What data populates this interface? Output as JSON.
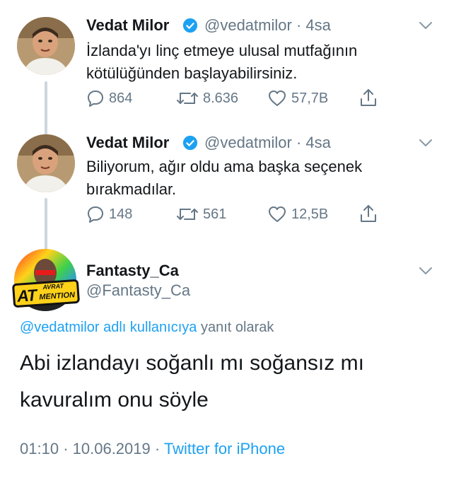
{
  "tweets": [
    {
      "name": "Vedat Milor",
      "handle": "@vedatmilor",
      "time": "· 4sa",
      "text_lines": [
        "İzlanda'yı linç etmeye ulusal mutfağının",
        "kötülüğünden başlayabilirsiniz."
      ],
      "replies": "864",
      "retweets": "8.636",
      "likes": "57,7B"
    },
    {
      "name": "Vedat Milor",
      "handle": "@vedatmilor",
      "time": "· 4sa",
      "text_lines": [
        "Biliyorum, ağır oldu ama başka seçenek",
        "bırakmadılar."
      ],
      "replies": "148",
      "retweets": "561",
      "likes": "12,5B"
    }
  ],
  "reply": {
    "name": "Fantasty_Ca",
    "handle": "@Fantasty_Ca",
    "avatar_badge_top": "AVRAT",
    "avatar_badge_main": "AT",
    "avatar_badge_bottom": "MENTION",
    "reply_to_link": "@vedatmilor adlı kullanıcıya",
    "reply_to_suffix": "yanıt olarak",
    "text_lines": [
      "Abi izlandayı soğanlı mı soğansız mı",
      "kavuralım onu söyle"
    ],
    "time": "01:10",
    "sep1": "·",
    "date": "10.06.2019",
    "sep2": "·",
    "source": "Twitter for iPhone"
  },
  "colors": {
    "verified": "#1da1f2",
    "link": "#1da1f2",
    "muted": "#657786",
    "thread_line": "#ccd6dd"
  },
  "icons": [
    "reply-icon",
    "retweet-icon",
    "like-icon",
    "share-icon",
    "verified-badge-icon",
    "chevron-down-icon"
  ]
}
